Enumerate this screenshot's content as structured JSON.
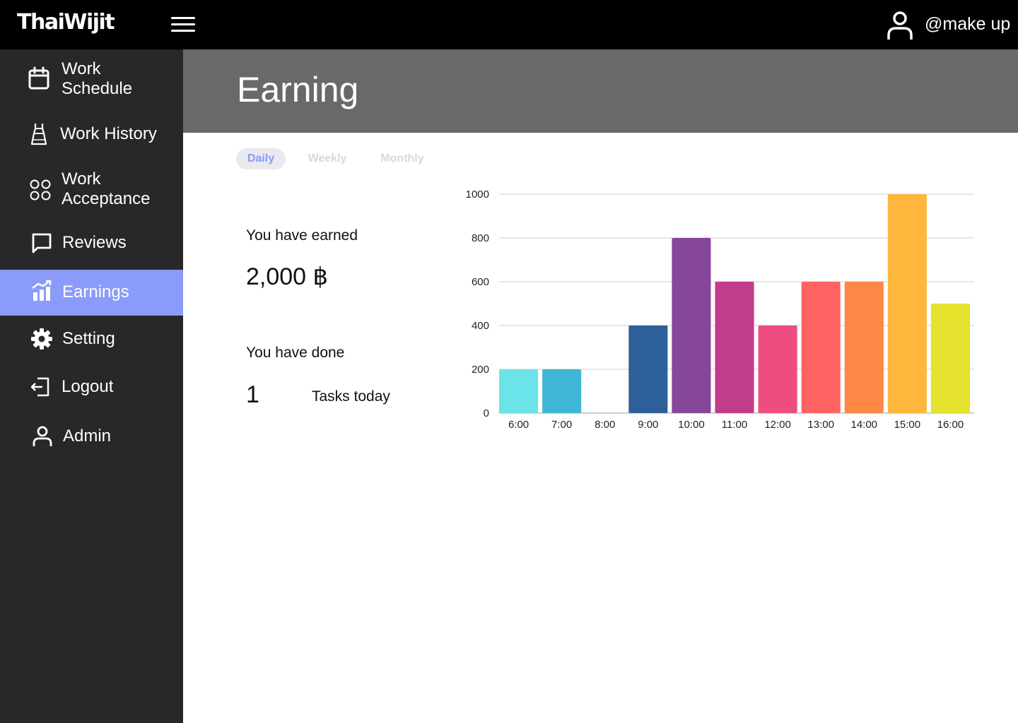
{
  "app": {
    "logo": "ThaiWijit",
    "username": "@make up"
  },
  "sidebar": {
    "items": [
      {
        "label": "Work\nSchedule",
        "icon": "calendar-icon"
      },
      {
        "label": "Work History",
        "icon": "dress-icon"
      },
      {
        "label": "Work\nAcceptance",
        "icon": "four-circles-icon"
      },
      {
        "label": "Reviews",
        "icon": "chat-bubble-icon"
      },
      {
        "label": "Earnings",
        "icon": "bar-chart-icon",
        "active": true
      },
      {
        "label": "Setting",
        "icon": "gear-icon"
      },
      {
        "label": "Logout",
        "icon": "logout-icon"
      },
      {
        "label": "Admin",
        "icon": "user-icon"
      }
    ]
  },
  "page": {
    "title": "Earning"
  },
  "tabs": [
    {
      "label": "Daily",
      "active": true
    },
    {
      "label": "Weekly"
    },
    {
      "label": "Monthly"
    }
  ],
  "stats": {
    "earned_label": "You have earned",
    "earned_value": "2,000 ฿",
    "done_label": "You have done",
    "done_value": "1",
    "done_suffix": "Tasks today"
  },
  "colors": {
    "topbar": "#000000",
    "sidebar": "#282828",
    "active_item": "#8a9bf9",
    "header_band": "#696969"
  },
  "chart_data": {
    "type": "bar",
    "categories": [
      "6:00",
      "7:00",
      "8:00",
      "9:00",
      "10:00",
      "11:00",
      "12:00",
      "13:00",
      "14:00",
      "15:00",
      "16:00"
    ],
    "values": [
      200,
      200,
      0,
      400,
      800,
      600,
      400,
      600,
      600,
      1000,
      500
    ],
    "colors": [
      "#6ae4e8",
      "#3fb6d6",
      "#5c8fd6",
      "#2d5f99",
      "#864699",
      "#c23c8c",
      "#ee4d7f",
      "#ff6262",
      "#ff8745",
      "#ffb63c",
      "#e4e22c"
    ],
    "ylim": [
      0,
      1000
    ],
    "yticks": [
      0,
      200,
      400,
      600,
      800,
      1000
    ],
    "grid": true,
    "legend": "none"
  }
}
